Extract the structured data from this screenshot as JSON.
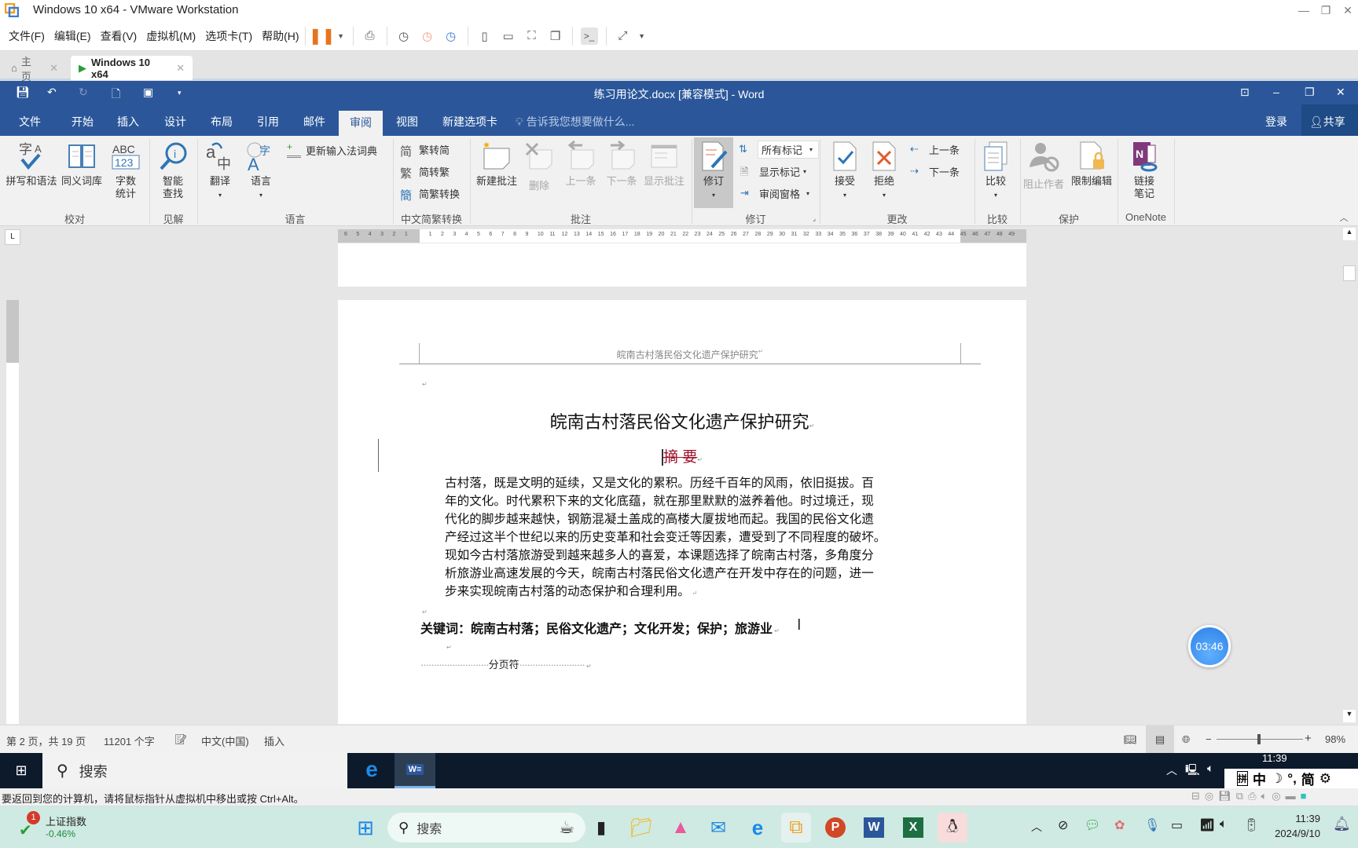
{
  "vmware": {
    "title": "Windows 10 x64 - VMware Workstation",
    "menu": [
      "文件(F)",
      "编辑(E)",
      "查看(V)",
      "虚拟机(M)",
      "选项卡(T)",
      "帮助(H)"
    ],
    "tabs": [
      {
        "label": "主页",
        "icon": "home-icon"
      },
      {
        "label": "Windows 10 x64",
        "icon": "vm-icon",
        "active": true
      }
    ],
    "hint": "要返回到您的计算机，请将鼠标指针从虚拟机中移出或按 Ctrl+Alt。"
  },
  "word": {
    "title": "练习用论文.docx [兼容模式] - Word",
    "login": "登录",
    "share": "共享",
    "tabs": [
      "文件",
      "开始",
      "插入",
      "设计",
      "布局",
      "引用",
      "邮件",
      "审阅",
      "视图",
      "新建选项卡"
    ],
    "active_tab": "审阅",
    "tell_me": "告诉我您想要做什么...",
    "ribbon": {
      "groups": [
        "校对",
        "见解",
        "语言",
        "中文简繁转换",
        "批注",
        "修订",
        "更改",
        "比较",
        "保护",
        "OneNote"
      ],
      "proofing": {
        "spelling": "拼写和语法",
        "thesaurus": "同义词库",
        "wordcount_1": "字数",
        "wordcount_2": "统计"
      },
      "insights": {
        "smart_1": "智能",
        "smart_2": "查找"
      },
      "language": {
        "translate": "翻译",
        "language": "语言",
        "update_ime": "更新输入法词典"
      },
      "chinese": {
        "t2s": "繁转简",
        "s2t": "简转繁",
        "convert": "简繁转换"
      },
      "comments": {
        "new": "新建批注",
        "delete": "删除",
        "prev": "上一条",
        "next": "下一条",
        "show": "显示批注"
      },
      "tracking": {
        "track": "修订",
        "markup_select": "所有标记",
        "show_markup": "显示标记",
        "pane": "审阅窗格"
      },
      "changes": {
        "accept": "接受",
        "reject": "拒绝",
        "prev": "上一条",
        "next": "下一条"
      },
      "compare": {
        "compare": "比较"
      },
      "protect": {
        "block": "阻止作者",
        "restrict": "限制编辑"
      },
      "onenote": {
        "link_1": "链接",
        "link_2": "笔记"
      }
    },
    "document": {
      "header": "皖南古村落民俗文化遗产保护研究",
      "title": "皖南古村落民俗文化遗产保护研究",
      "abstract_heading": "摘 要",
      "abstract_lines": [
        "古村落，既是文明的延续，又是文化的累积。历经千百年的风雨，依旧挺拔。百",
        "年的文化。时代累积下来的文化底蕴，就在那里默默的滋养着他。时过境迁，现",
        "代化的脚步越来越快，钢筋混凝土盖成的高楼大厦拔地而起。我国的民俗文化遗",
        "产经过这半个世纪以来的历史变革和社会变迁等因素，遭受到了不同程度的破坏。",
        "现如今古村落旅游受到越来越多人的喜爱，本课题选择了皖南古村落，多角度分",
        "析旅游业高速发展的今天，皖南古村落民俗文化遗产在开发中存在的问题，进一",
        "步来实现皖南古村落的动态保护和合理利用。"
      ],
      "keywords": "关键词：皖南古村落；民俗文化遗产；文化开发；保护；旅游业",
      "page_break": "分页符",
      "ruler_left": [
        "6",
        "5",
        "4",
        "3",
        "2",
        "1"
      ],
      "ruler_main": [
        "1",
        "2",
        "3",
        "4",
        "5",
        "6",
        "7",
        "8",
        "9",
        "10",
        "11",
        "12",
        "13",
        "14",
        "15",
        "16",
        "17",
        "18",
        "19",
        "20",
        "21",
        "22",
        "23",
        "24",
        "25",
        "26",
        "27",
        "28",
        "29",
        "30",
        "31",
        "32",
        "33",
        "34",
        "35",
        "36",
        "37",
        "38",
        "39",
        "40",
        "41",
        "42",
        "43",
        "44"
      ],
      "ruler_right": [
        "45",
        "46",
        "47",
        "48",
        "49"
      ]
    },
    "status": {
      "page": "第 2 页，共 19 页",
      "words": "11201 个字",
      "lang": "中文(中国)",
      "mode": "插入",
      "zoom": "98%",
      "zoom_value": 98
    }
  },
  "timer": "03:46",
  "guest_taskbar": {
    "search": "搜索",
    "clock": "11:39",
    "ime": [
      "拼",
      "中",
      "简"
    ]
  },
  "host_taskbar": {
    "stock_name": "上证指数",
    "stock_change": "-0.46%",
    "stock_badge": "1",
    "search": "搜索",
    "time": "11:39",
    "date": "2024/9/10",
    "accent_color": "#cfeae2"
  }
}
